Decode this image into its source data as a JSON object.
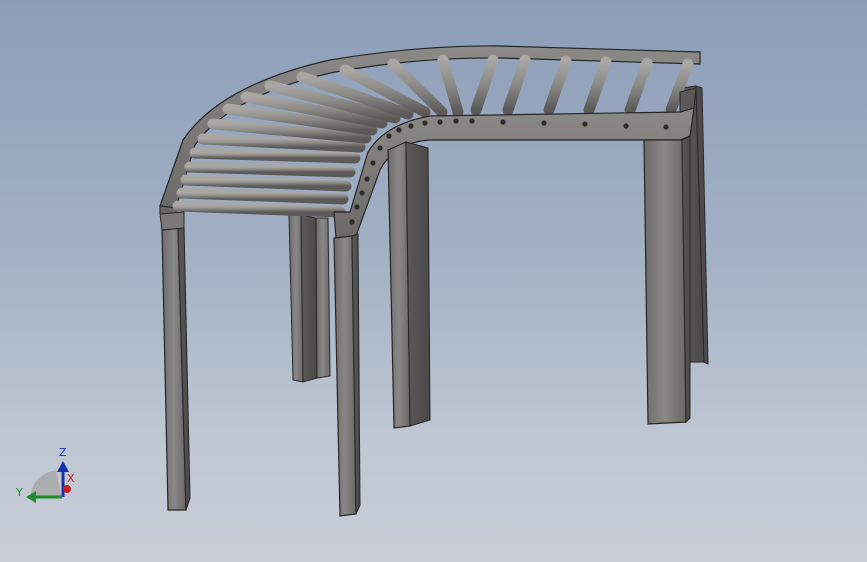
{
  "view": {
    "background_top": "#8b9db8",
    "background_bottom": "#c9ced8"
  },
  "model": {
    "name": "",
    "parts": [
      "curved-roller-conveyor",
      "support-legs",
      "rollers",
      "side-rails"
    ]
  },
  "triad": {
    "z_label": "Z",
    "y_label": "Y",
    "x_label": "X",
    "z_color": "#1a2fb0",
    "y_color": "#1f8a2a",
    "x_color": "#c81e1e"
  }
}
